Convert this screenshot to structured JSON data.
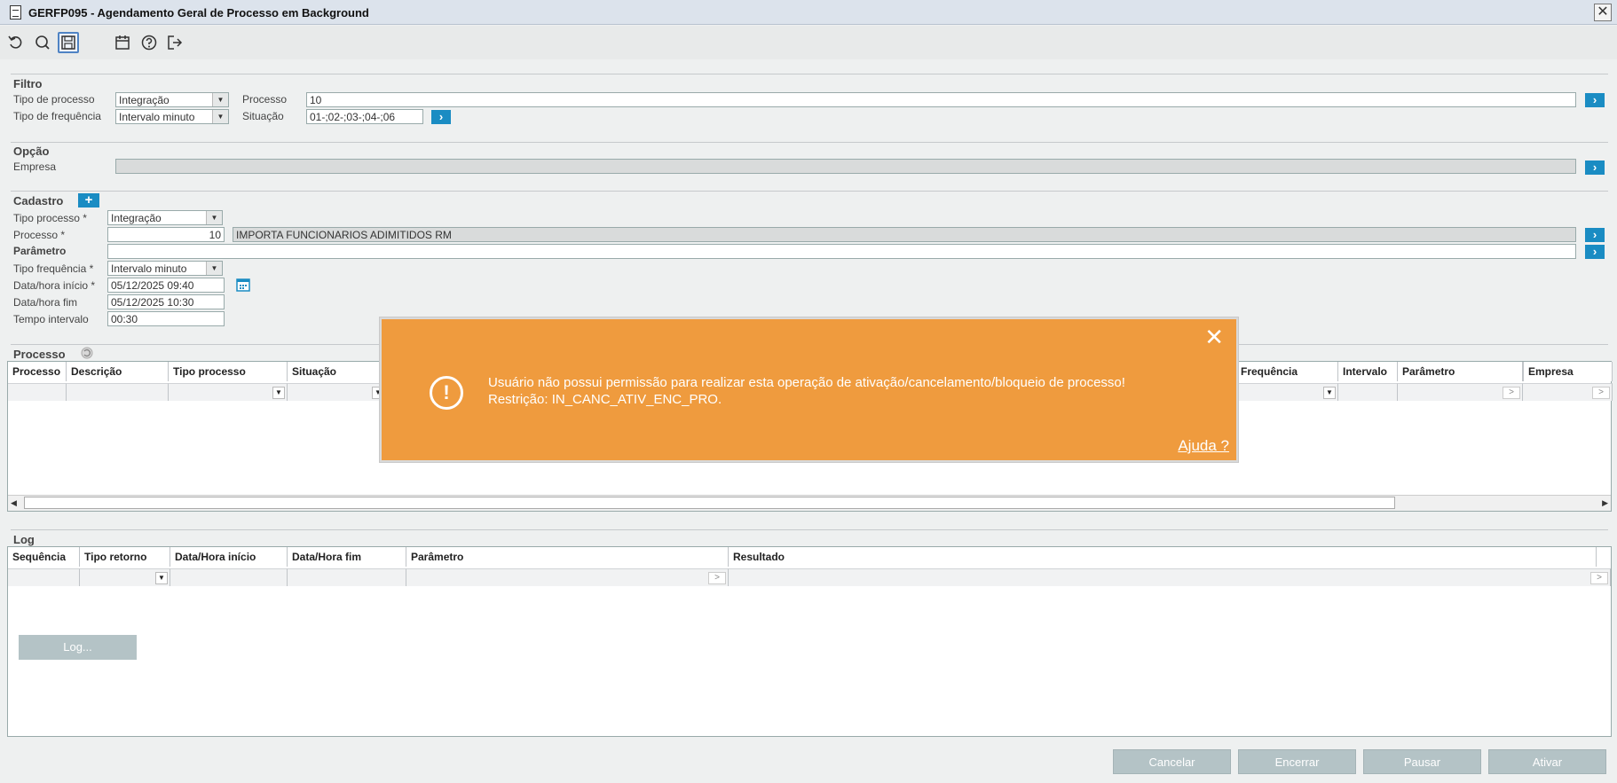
{
  "window": {
    "title": "GERFP095 - Agendamento Geral de Processo em Background",
    "close": "✕"
  },
  "toolbar": {
    "icons": [
      "undo-icon",
      "search-icon",
      "save-icon",
      "calendar-icon",
      "help-icon",
      "exit-icon"
    ]
  },
  "filtro": {
    "title": "Filtro",
    "tipo_processo_label": "Tipo de processo",
    "tipo_processo_value": "Integração",
    "processo_label": "Processo",
    "processo_value": "10",
    "tipo_frequencia_label": "Tipo de frequência",
    "tipo_frequencia_value": "Intervalo minuto",
    "situacao_label": "Situação",
    "situacao_value": "01-;02-;03-;04-;06"
  },
  "opcao": {
    "title": "Opção",
    "empresa_label": "Empresa",
    "empresa_value": ""
  },
  "cadastro": {
    "title": "Cadastro",
    "tipo_processo_label": "Tipo processo *",
    "tipo_processo_value": "Integração",
    "processo_label": "Processo *",
    "processo_code": "10",
    "processo_desc": "IMPORTA FUNCIONARIOS ADIMITIDOS RM",
    "parametro_label": "Parâmetro",
    "parametro_value": "",
    "tipo_frequencia_label": "Tipo frequência *",
    "tipo_frequencia_value": "Intervalo minuto",
    "inicio_label": "Data/hora início *",
    "inicio_value": "05/12/2025 09:40",
    "fim_label": "Data/hora fim",
    "fim_value": "05/12/2025 10:30",
    "intervalo_label": "Tempo intervalo",
    "intervalo_value": "00:30"
  },
  "processo_grid": {
    "title": "Processo",
    "columns": [
      "Processo",
      "Descrição",
      "Tipo processo",
      "Situação",
      "Frequência",
      "Intervalo",
      "Parâmetro",
      "Empresa"
    ]
  },
  "log": {
    "title": "Log",
    "columns": [
      "Sequência",
      "Tipo retorno",
      "Data/Hora início",
      "Data/Hora fim",
      "Parâmetro",
      "Resultado"
    ],
    "button": "Log..."
  },
  "footer": {
    "cancelar": "Cancelar",
    "encerrar": "Encerrar",
    "pausar": "Pausar",
    "ativar": "Ativar"
  },
  "toast": {
    "line1": "Usuário não possui permissão para realizar esta operação de ativação/cancelamento/bloqueio de processo!",
    "line2": "Restrição: IN_CANC_ATIV_ENC_PRO.",
    "help": "Ajuda ?",
    "close": "✕",
    "icon": "!",
    "color": "#ef9b3e"
  }
}
